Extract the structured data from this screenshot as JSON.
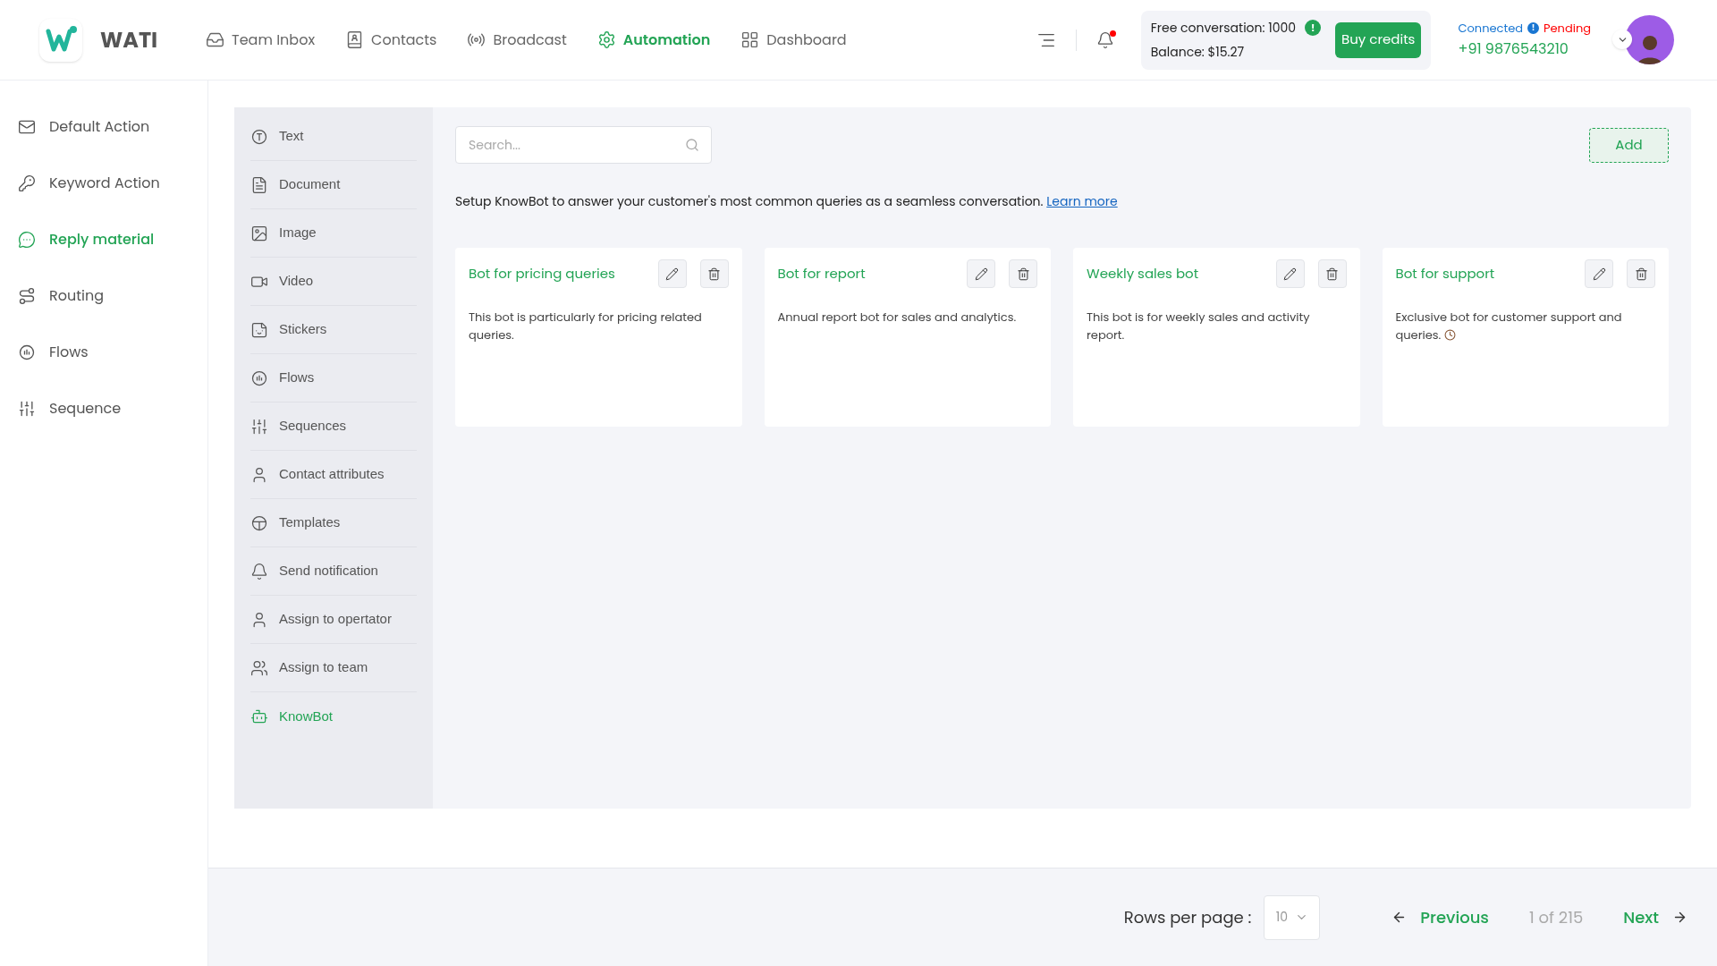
{
  "logo": {
    "name": "WATI"
  },
  "nav": [
    {
      "label": "Team Inbox",
      "selected": false
    },
    {
      "label": "Contacts",
      "selected": false
    },
    {
      "label": "Broadcast",
      "selected": false
    },
    {
      "label": "Automation",
      "selected": true
    },
    {
      "label": "Dashboard",
      "selected": false
    }
  ],
  "notifications": {
    "unread": true
  },
  "credits": {
    "free": "Free conversation: 1000",
    "alert": "!",
    "balance": "Balance: $15.27",
    "button": "Buy credits"
  },
  "account": {
    "status": "Connected",
    "alert": "!",
    "pending": "Pending",
    "phone": "+91 9876543210"
  },
  "sidebar": {
    "items": [
      {
        "label": "Default Action",
        "selected": false
      },
      {
        "label": "Keyword Action",
        "selected": false
      },
      {
        "label": "Reply material",
        "selected": true
      },
      {
        "label": "Routing",
        "selected": false
      },
      {
        "label": "Flows",
        "selected": false
      },
      {
        "label": "Sequence",
        "selected": false
      }
    ]
  },
  "submenu": {
    "items": [
      {
        "label": "Text",
        "selected": false
      },
      {
        "label": "Document",
        "selected": false
      },
      {
        "label": "Image",
        "selected": false
      },
      {
        "label": "Video",
        "selected": false
      },
      {
        "label": "Stickers",
        "selected": false
      },
      {
        "label": "Flows",
        "selected": false
      },
      {
        "label": "Sequences",
        "selected": false
      },
      {
        "label": "Contact attributes",
        "selected": false
      },
      {
        "label": "Templates",
        "selected": false
      },
      {
        "label": "Send notification",
        "selected": false
      },
      {
        "label": "Assign to opertator",
        "selected": false
      },
      {
        "label": "Assign to team",
        "selected": false
      },
      {
        "label": "KnowBot",
        "selected": true
      }
    ]
  },
  "search": {
    "placeholder": "Search..."
  },
  "add_button": "Add",
  "intro": {
    "text": "Setup KnowBot to answer your customer's most common queries as a seamless conversation.",
    "link": "Learn more"
  },
  "cards": [
    {
      "title": "Bot for pricing queries",
      "description": "This bot is particularly for pricing related queries."
    },
    {
      "title": "Bot for report",
      "description": "Annual report bot for sales and analytics."
    },
    {
      "title": "Weekly sales bot",
      "description": "This bot is for weekly sales and activity report."
    },
    {
      "title": "Bot for support",
      "description": "Exclusive bot for customer support and queries.",
      "emoji": true
    }
  ],
  "pagination": {
    "rows_label": "Rows per page :",
    "rows_value": "10",
    "previous": "Previous",
    "page": "1 of 215",
    "next": "Next"
  }
}
